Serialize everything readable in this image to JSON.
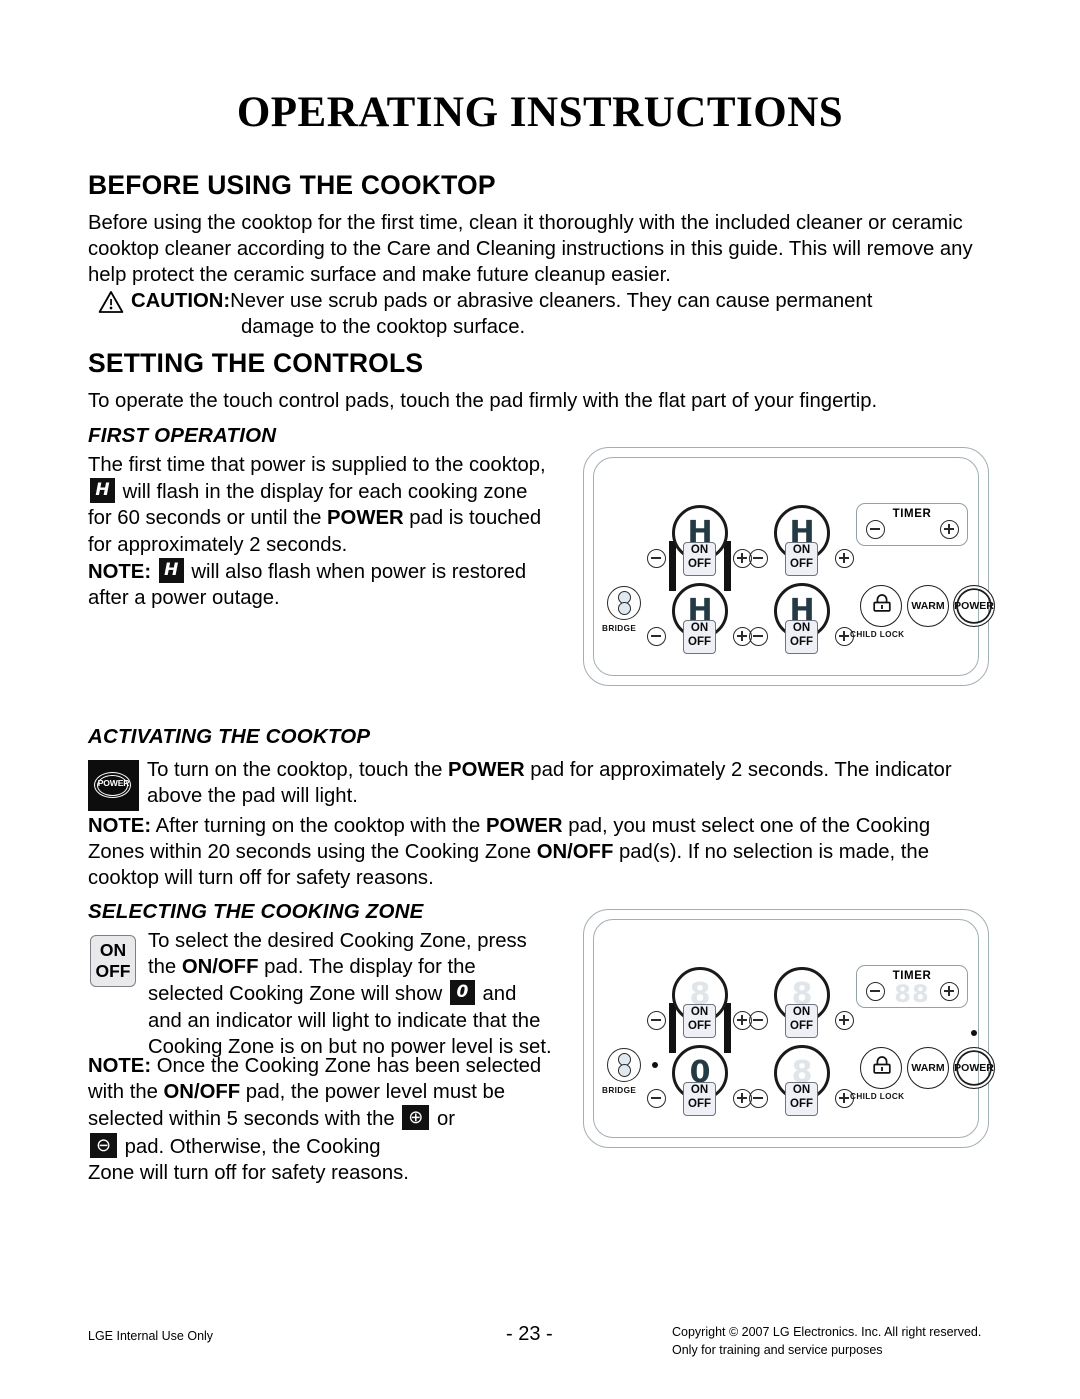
{
  "document": {
    "title": "OPERATING INSTRUCTIONS"
  },
  "sections": {
    "before_using": {
      "heading": "BEFORE USING THE COOKTOP",
      "body": "Before using the cooktop for the first time, clean it thoroughly with the included cleaner or ceramic cooktop cleaner according to the Care and Cleaning instructions in this guide. This will remove any help protect the ceramic surface and make future cleanup easier.",
      "caution_label": "CAUTION:",
      "caution_text": "Never use scrub pads or abrasive cleaners. They can cause permanent",
      "caution_text_2": "damage to the cooktop surface.",
      "caution_icon": "warning-triangle-icon"
    },
    "setting_controls": {
      "heading": "SETTING THE CONTROLS",
      "body": "To operate the touch control pads, touch the pad firmly with the flat part of your fingertip."
    },
    "first_operation": {
      "heading": "FIRST OPERATION",
      "line1": "The first time that power is supplied to the cooktop,",
      "badge_h": "H",
      "line2": "will flash in the display for each cooking zone",
      "line3_a": "for 60 seconds or until the ",
      "line3_b": "POWER",
      "line3_c": " pad is touched",
      "line4": "for approximately 2 seconds.",
      "note_label": "NOTE:",
      "note_rest": "will also flash when power is restored",
      "note_line2": "after a power outage."
    },
    "activating": {
      "heading": "ACTIVATING THE COOKTOP",
      "badge_power": "POWER",
      "body_a": "To turn on the cooktop, touch the ",
      "body_b": "POWER",
      "body_c": " pad for approximately 2 seconds. The indicator above the pad will light.",
      "note_label": "NOTE:",
      "note_a": " After turning on the cooktop with the ",
      "note_b": "POWER",
      "note_c": " pad, you must select one of the Cooking Zones within 20 seconds using the Cooking Zone ",
      "note_d": "ON/OFF",
      "note_e": " pad(s). If no selection is made, the cooktop will turn off for safety reasons."
    },
    "selecting_zone": {
      "heading": "SELECTING THE COOKING ZONE",
      "badge_on": "ON",
      "badge_off": "OFF",
      "line1": "To select the desired Cooking Zone, press",
      "line2_a": "the ",
      "line2_b": "ON/OFF",
      "line2_c": " pad. The display for the",
      "line3_a": "selected Cooking Zone will show",
      "line3_badge": "0",
      "line3_b": "and",
      "line4": "and an indicator will light to indicate that the",
      "line5": "Cooking Zone is on but no power level is set.",
      "note_label": "NOTE:",
      "note_line1": " Once the Cooking Zone has been selected",
      "note_line2_a": "with the ",
      "note_line2_b": "ON/OFF",
      "note_line2_c": " pad, the power level must be",
      "note_line3_a": "selected within 5 seconds with the",
      "note_line3_plus": "⊕",
      "note_line3_b": "or",
      "note_line4_minus": "⊖",
      "note_line4_a": "pad. Otherwise, the Cooking",
      "note_line5": "Zone will turn off for safety reasons."
    }
  },
  "cooktop_first": {
    "name": "cooktop-control-panel-first-operation",
    "zones": [
      {
        "id": "rear-left",
        "display": "H",
        "dim": false,
        "on_label": "ON",
        "off_label": "OFF"
      },
      {
        "id": "rear-right",
        "display": "H",
        "dim": false,
        "on_label": "ON",
        "off_label": "OFF"
      },
      {
        "id": "front-left",
        "display": "H",
        "dim": false,
        "on_label": "ON",
        "off_label": "OFF"
      },
      {
        "id": "front-right",
        "display": "H",
        "dim": false,
        "on_label": "ON",
        "off_label": "OFF"
      }
    ],
    "bridge_label": "BRIDGE",
    "timer_label": "TIMER",
    "timer_digits": "",
    "child_lock_label": "CHILD LOCK",
    "warm_label": "WARM",
    "power_label": "POWER",
    "zone_indicator_on": false,
    "power_indicator_on": false
  },
  "cooktop_second": {
    "name": "cooktop-control-panel-selecting-zone",
    "zones": [
      {
        "id": "rear-left",
        "display": "8",
        "dim": true,
        "on_label": "ON",
        "off_label": "OFF"
      },
      {
        "id": "rear-right",
        "display": "8",
        "dim": true,
        "on_label": "ON",
        "off_label": "OFF"
      },
      {
        "id": "front-left",
        "display": "0",
        "dim": false,
        "on_label": "ON",
        "off_label": "OFF"
      },
      {
        "id": "front-right",
        "display": "8",
        "dim": true,
        "on_label": "ON",
        "off_label": "OFF"
      }
    ],
    "bridge_label": "BRIDGE",
    "timer_label": "TIMER",
    "timer_digits": "88",
    "child_lock_label": "CHILD LOCK",
    "warm_label": "WARM",
    "power_label": "POWER",
    "zone_indicator_on": true,
    "power_indicator_on": true
  },
  "footer": {
    "left": "LGE Internal Use Only",
    "page": "- 23 -",
    "copyright_line1": "Copyright © 2007 LG Electronics. Inc. All right reserved.",
    "copyright_line2": "Only for training and service purposes"
  }
}
